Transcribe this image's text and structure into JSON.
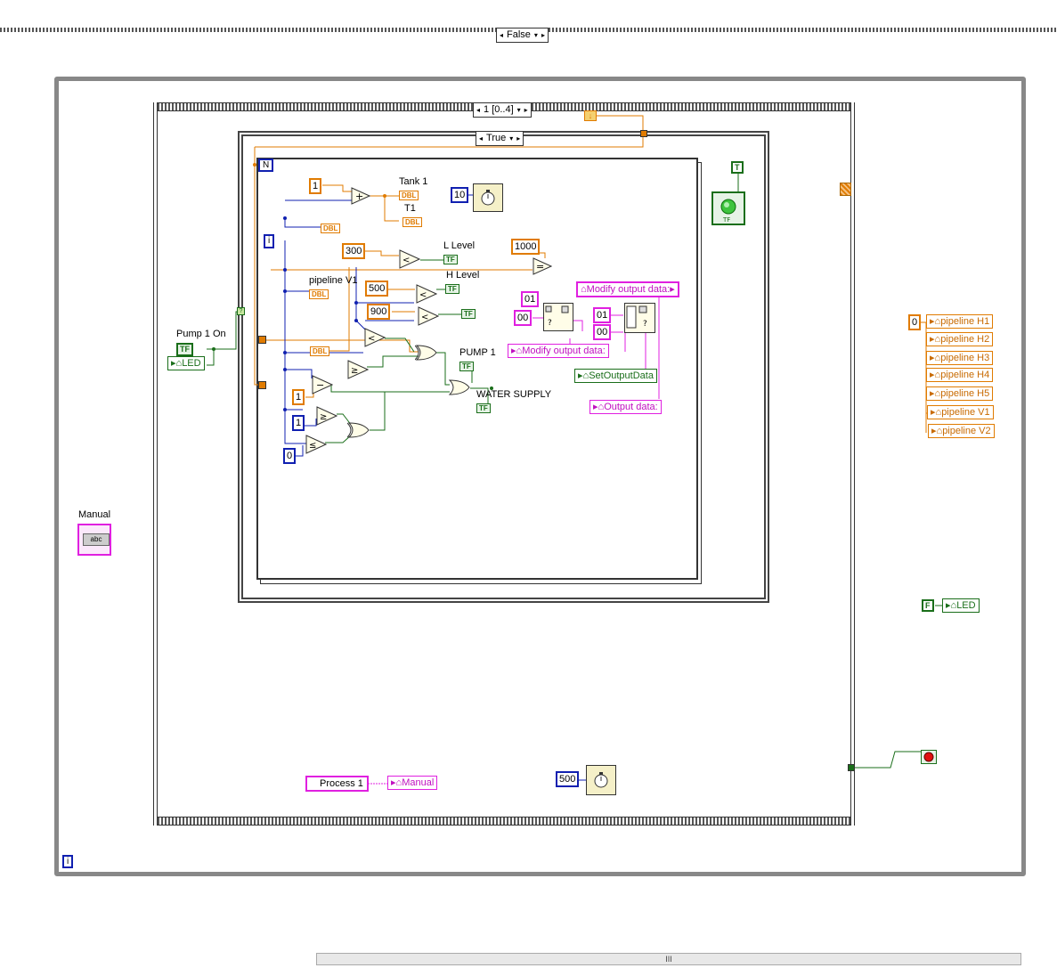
{
  "outer_case": {
    "selector": "False"
  },
  "sequence": {
    "selector": "1 [0..4]"
  },
  "inner_case": {
    "selector": "True"
  },
  "loop": {
    "n_label": "N",
    "i_label": "i",
    "outer_i_label": "i"
  },
  "labels": {
    "tank1": "Tank 1",
    "t1": "T1",
    "l_level": "L Level",
    "h_level": "H Level",
    "pipeline_v1": "pipeline V1",
    "pump1": "PUMP 1",
    "water_supply": "WATER SUPPLY",
    "pump1_on": "Pump 1 On",
    "manual": "Manual"
  },
  "constants": {
    "one_a": "1",
    "ten": "10",
    "three_hundred": "300",
    "thousand": "1000",
    "five_hundred_a": "500",
    "nine_hundred": "900",
    "one_b": "1",
    "one_c": "1",
    "zero_a": "0",
    "hex_01_a": "01",
    "hex_00_a": "00",
    "hex_01_b": "01",
    "hex_00_b": "00",
    "five_hundred_b": "500",
    "zero_b": "0",
    "true_const": "T",
    "false_const": "F",
    "process1": "Process 1"
  },
  "indicator_tags": {
    "dbl": "DBL",
    "tf": "TF",
    "abc": "abc"
  },
  "locals": {
    "led_left": "LED",
    "modify_top": "Modify output data:",
    "modify_mid": "Modify output data:",
    "set_output": "SetOutputData",
    "output_data": "Output data:",
    "manual_local": "Manual",
    "led_right": "LED",
    "pipelines": [
      "pipeline H1",
      "pipeline H2",
      "pipeline H3",
      "pipeline H4",
      "pipeline H5",
      "pipeline V1",
      "pipeline V2"
    ]
  },
  "scrollbar": {
    "grip": "III"
  },
  "colors": {
    "orange": "#e07b00",
    "blue": "#1020b0",
    "green": "#1a6e1a",
    "pink": "#e020e0",
    "frame": "#888888"
  }
}
